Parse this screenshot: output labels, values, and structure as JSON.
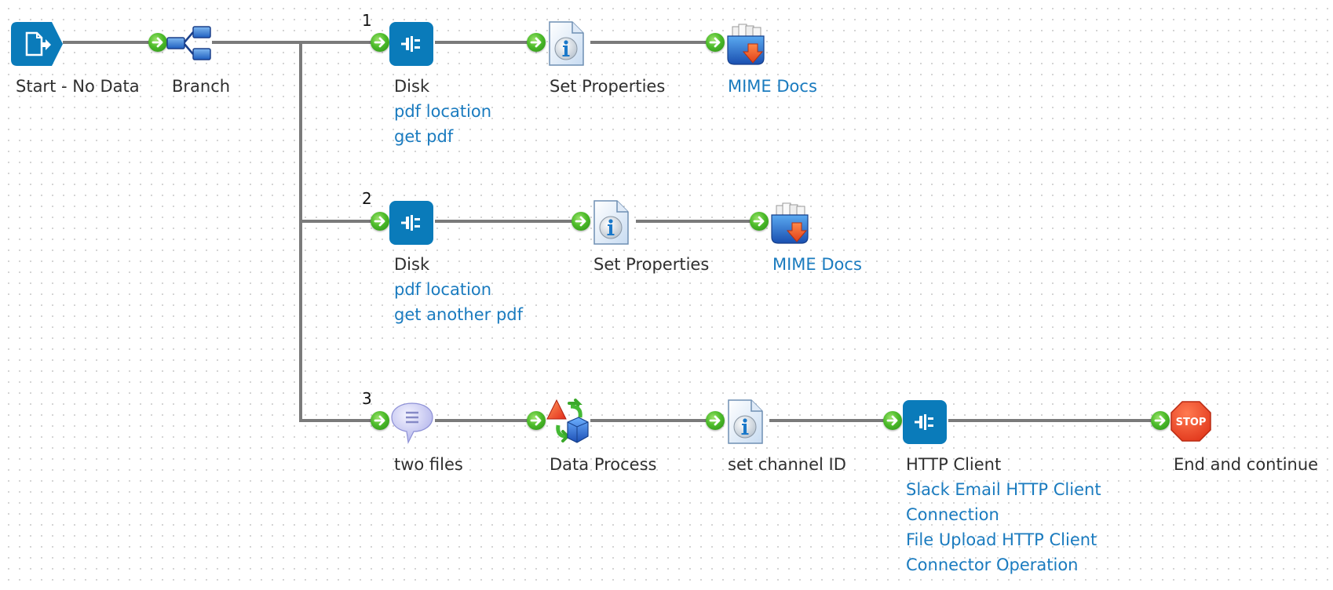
{
  "canvas": {
    "connector_color": "#7a7a7a",
    "tile_color": "#0a7bba",
    "link_color": "#1a7bbf",
    "text_color": "#2f2f2f"
  },
  "branch_numbers": [
    "1",
    "2",
    "3"
  ],
  "shapes": {
    "start": {
      "label": "Start - No Data",
      "icon": "document-arrow-icon"
    },
    "branch": {
      "label": "Branch",
      "icon": "branch-icon"
    },
    "path1": {
      "disk": {
        "label": "Disk",
        "sub": [
          "pdf location",
          "get pdf"
        ],
        "icon": "connector-plug-icon"
      },
      "set_properties": {
        "label": "Set Properties",
        "icon": "document-info-icon"
      },
      "mime": {
        "label": "MIME Docs",
        "icon": "mime-docs-icon"
      }
    },
    "path2": {
      "disk": {
        "label": "Disk",
        "sub": [
          "pdf location",
          "get another pdf"
        ],
        "icon": "connector-plug-icon"
      },
      "set_properties": {
        "label": "Set Properties",
        "icon": "document-info-icon"
      },
      "mime": {
        "label": "MIME Docs",
        "icon": "mime-docs-icon"
      }
    },
    "path3": {
      "notify": {
        "label": "two files",
        "icon": "speech-bubble-icon"
      },
      "data_process": {
        "label": "Data Process",
        "icon": "data-process-icon"
      },
      "set_channel": {
        "label": "set channel ID",
        "icon": "document-info-icon"
      },
      "http": {
        "label": "HTTP Client",
        "sub": [
          "Slack Email HTTP Client",
          "Connection",
          "File Upload HTTP Client",
          "Connector Operation"
        ],
        "icon": "connector-plug-icon"
      },
      "stop": {
        "label": "End and continue",
        "icon_text": "STOP",
        "icon": "stop-sign-icon"
      }
    }
  }
}
